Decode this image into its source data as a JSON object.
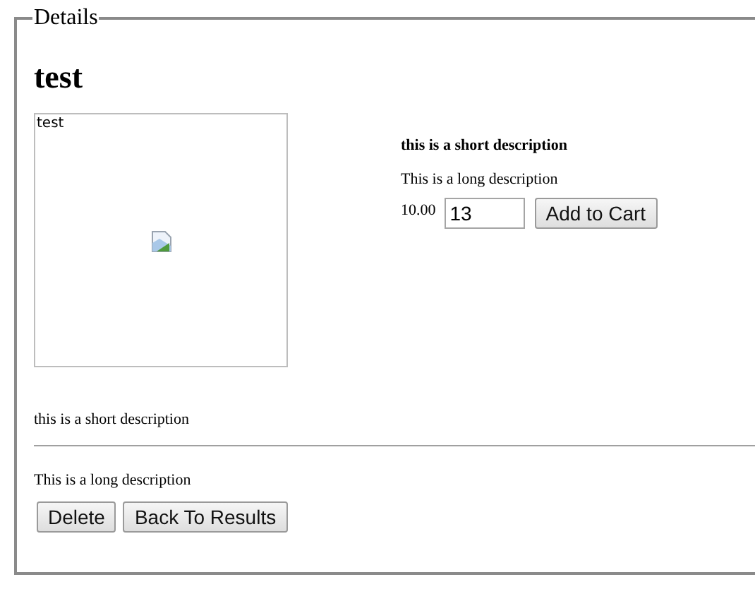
{
  "fieldset": {
    "legend": "Details"
  },
  "product": {
    "title": "test",
    "image": {
      "alt": "test"
    },
    "short_description": "this is a short description",
    "long_description": "This is a long description",
    "price": "10.00",
    "quantity": "13",
    "add_button": "Add to Cart"
  },
  "footer": {
    "short_description": "this is a short description",
    "long_description": "This is a long description"
  },
  "buttons": [
    "Delete",
    "Back To Results"
  ]
}
